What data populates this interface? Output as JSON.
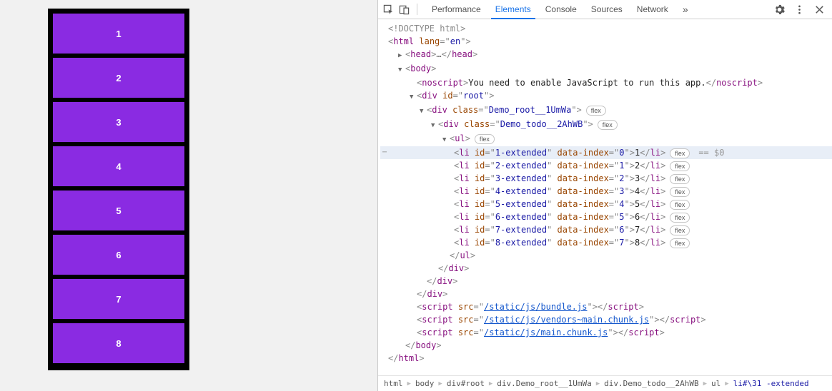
{
  "app": {
    "items": [
      "1",
      "2",
      "3",
      "4",
      "5",
      "6",
      "7",
      "8"
    ]
  },
  "devtools": {
    "tabs": {
      "performance": "Performance",
      "elements": "Elements",
      "console": "Console",
      "sources": "Sources",
      "network": "Network",
      "more": "»"
    },
    "elements": {
      "doctype": "<!DOCTYPE html>",
      "html_open": {
        "tag": "html",
        "attr_name": "lang",
        "attr_val": "en"
      },
      "head": {
        "open_tag": "head",
        "ellipsis": "…",
        "close_tag": "head"
      },
      "body_tag": "body",
      "noscript": {
        "tag": "noscript",
        "text": "You need to enable JavaScript to run this app."
      },
      "root_div": {
        "tag": "div",
        "attr_name": "id",
        "attr_val": "root"
      },
      "demo_root": {
        "tag": "div",
        "attr_name": "class",
        "attr_val": "Demo_root__1UmWa",
        "pill": "flex"
      },
      "demo_todo": {
        "tag": "div",
        "attr_name": "class",
        "attr_val": "Demo_todo__2AhWB",
        "pill": "flex"
      },
      "ul_tag": "ul",
      "ul_pill": "flex",
      "li_pill": "flex",
      "items": [
        {
          "id": "1-extended",
          "index": "0",
          "text": "1"
        },
        {
          "id": "2-extended",
          "index": "1",
          "text": "2"
        },
        {
          "id": "3-extended",
          "index": "2",
          "text": "3"
        },
        {
          "id": "4-extended",
          "index": "3",
          "text": "4"
        },
        {
          "id": "5-extended",
          "index": "4",
          "text": "5"
        },
        {
          "id": "6-extended",
          "index": "5",
          "text": "6"
        },
        {
          "id": "7-extended",
          "index": "6",
          "text": "7"
        },
        {
          "id": "8-extended",
          "index": "7",
          "text": "8"
        }
      ],
      "selected_hint": "== $0",
      "scripts": [
        "/static/js/bundle.js",
        "/static/js/vendors~main.chunk.js",
        "/static/js/main.chunk.js"
      ],
      "close_body": "body",
      "close_html": "html"
    },
    "crumbs": [
      "html",
      "body",
      "div#root",
      "div.Demo_root__1UmWa",
      "div.Demo_todo__2AhWB",
      "ul",
      "li#\\31 -extended"
    ]
  }
}
